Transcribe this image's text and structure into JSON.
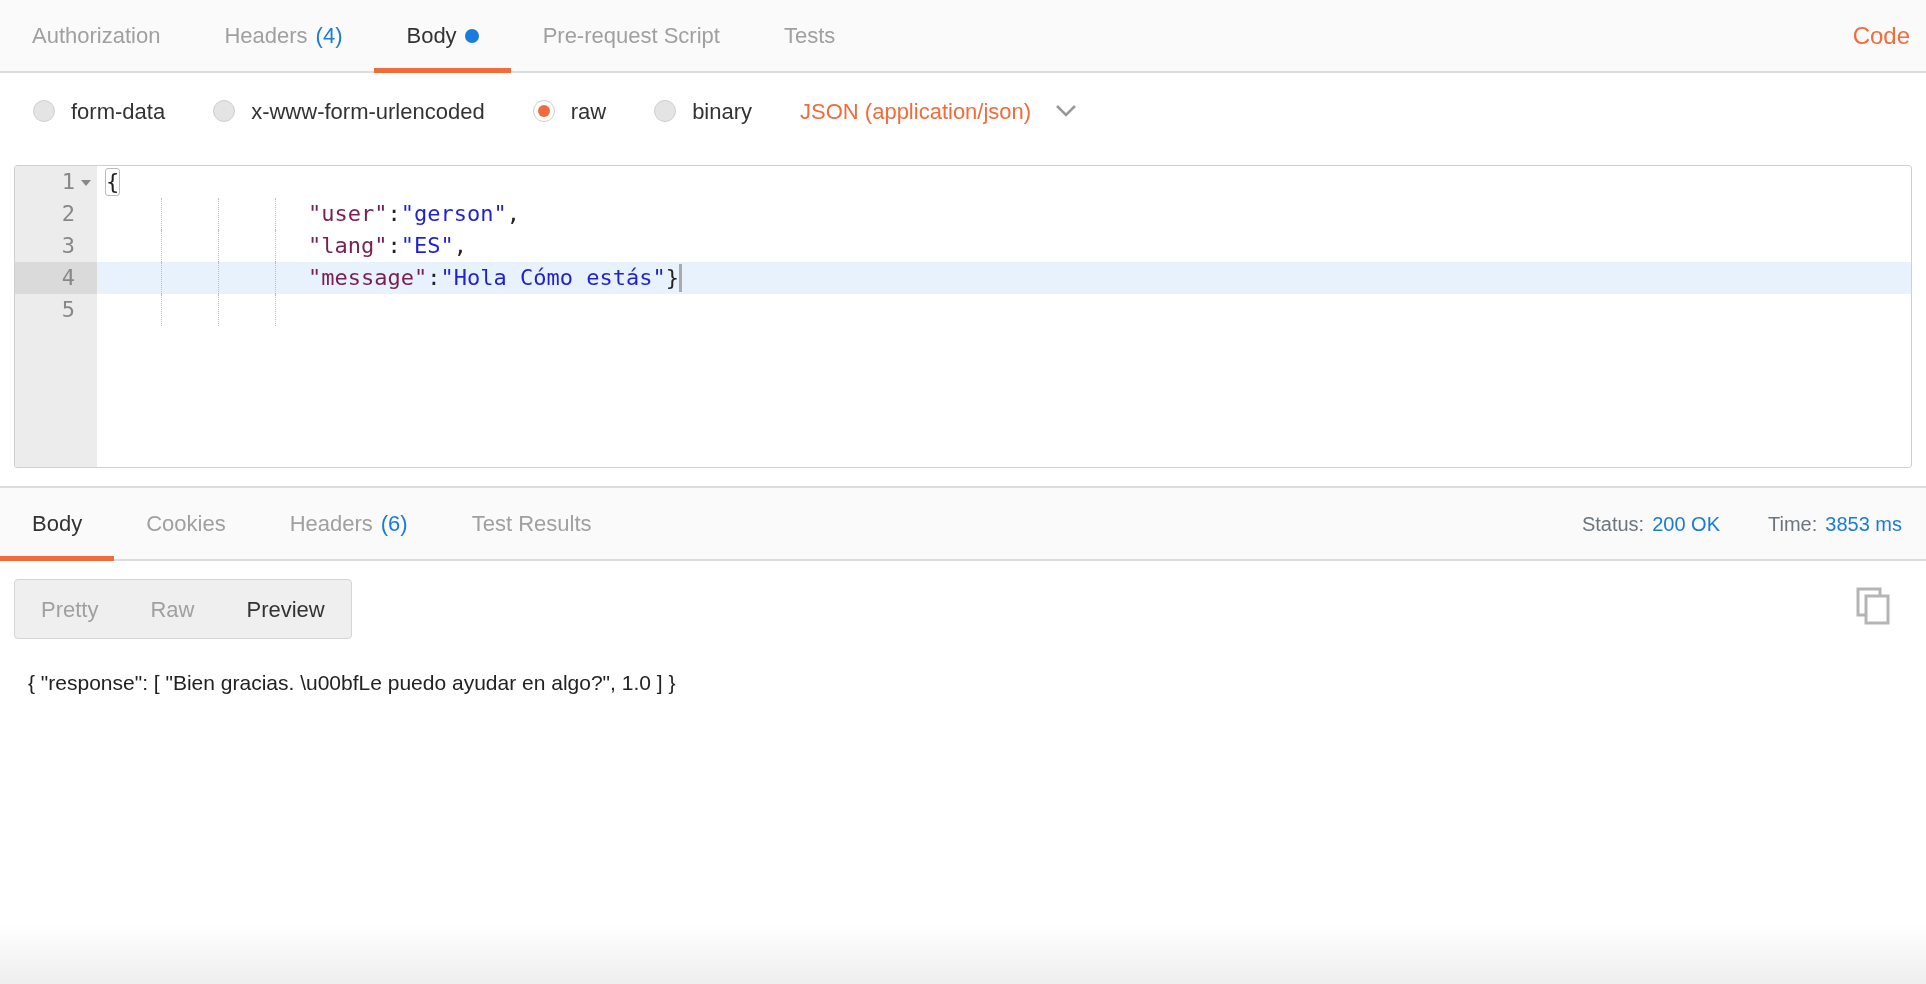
{
  "request_tabs": [
    {
      "label": "Authorization",
      "selected": false
    },
    {
      "label": "Headers",
      "count": "(4)",
      "selected": false
    },
    {
      "label": "Body",
      "selected": true,
      "modified": true
    },
    {
      "label": "Pre-request Script",
      "selected": false
    },
    {
      "label": "Tests",
      "selected": false
    }
  ],
  "code_link": "Code",
  "body_modes": [
    {
      "label": "form-data",
      "selected": false
    },
    {
      "label": "x-www-form-urlencoded",
      "selected": false
    },
    {
      "label": "raw",
      "selected": true
    },
    {
      "label": "binary",
      "selected": false
    }
  ],
  "content_type": "JSON (application/json)",
  "editor": {
    "lines": [
      {
        "number": "1",
        "foldable": true,
        "active": false,
        "indented": false,
        "cursor": false,
        "tokens": [
          {
            "kind": "brace-matched",
            "text": "{"
          }
        ]
      },
      {
        "number": "2",
        "foldable": false,
        "active": false,
        "indented": true,
        "cursor": false,
        "tokens": [
          {
            "kind": "key",
            "text": "\"user\""
          },
          {
            "kind": "punct",
            "text": ":"
          },
          {
            "kind": "string",
            "text": "\"gerson\""
          },
          {
            "kind": "punct",
            "text": ","
          }
        ]
      },
      {
        "number": "3",
        "foldable": false,
        "active": false,
        "indented": true,
        "cursor": false,
        "tokens": [
          {
            "kind": "key",
            "text": "\"lang\""
          },
          {
            "kind": "punct",
            "text": ":"
          },
          {
            "kind": "string",
            "text": "\"ES\""
          },
          {
            "kind": "punct",
            "text": ","
          }
        ]
      },
      {
        "number": "4",
        "foldable": false,
        "active": true,
        "indented": true,
        "cursor": true,
        "tokens": [
          {
            "kind": "key",
            "text": "\"message\""
          },
          {
            "kind": "punct",
            "text": ":"
          },
          {
            "kind": "string",
            "text": "\"Hola Cómo estás\""
          },
          {
            "kind": "punct",
            "text": "}"
          }
        ]
      },
      {
        "number": "5",
        "foldable": false,
        "active": false,
        "indented": true,
        "cursor": false
      }
    ]
  },
  "response_tabs": [
    {
      "label": "Body",
      "selected": true
    },
    {
      "label": "Cookies",
      "selected": false
    },
    {
      "label": "Headers",
      "count": "(6)",
      "selected": false
    },
    {
      "label": "Test Results",
      "selected": false
    }
  ],
  "status": {
    "label": "Status:",
    "value": "200 OK"
  },
  "time": {
    "label": "Time:",
    "value": "3853 ms"
  },
  "view_modes": [
    {
      "label": "Pretty",
      "selected": false
    },
    {
      "label": "Raw",
      "selected": false
    },
    {
      "label": "Preview",
      "selected": true
    }
  ],
  "response_body": "{ \"response\": [ \"Bien gracias. \\u00bfLe puedo ayudar en algo?\", 1.0 ] }"
}
